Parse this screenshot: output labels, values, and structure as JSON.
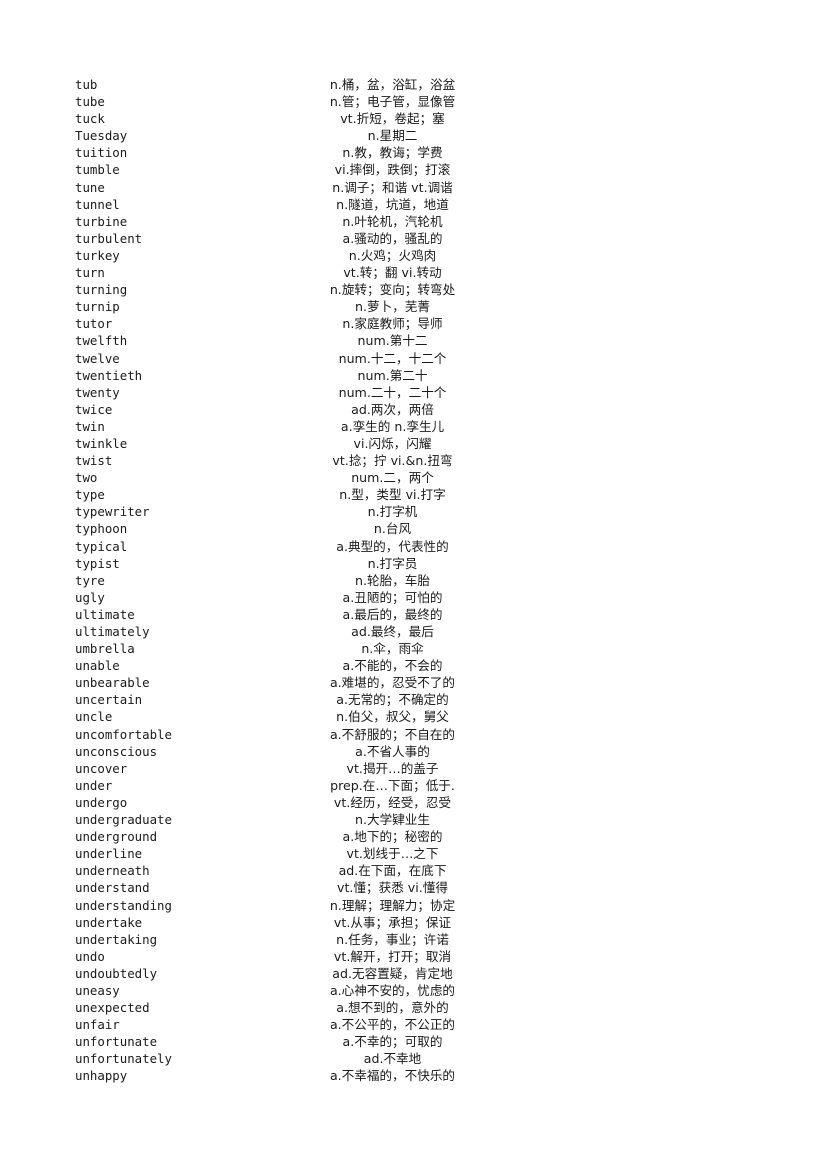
{
  "document": {
    "type": "vocabulary-list",
    "language_pair": "English-Chinese",
    "entry_count": 58,
    "first_term": "tub",
    "last_term": "unhappy"
  },
  "entries": [
    {
      "term": "tub",
      "definition": "n.桶，盆，浴缸，浴盆"
    },
    {
      "term": "tube",
      "definition": "n.管；电子管，显像管"
    },
    {
      "term": "tuck",
      "definition": "vt.折短，卷起；塞"
    },
    {
      "term": "Tuesday",
      "definition": "n.星期二"
    },
    {
      "term": "tuition",
      "definition": "n.教，教诲；学费"
    },
    {
      "term": "tumble",
      "definition": "vi.摔倒，跌倒；打滚"
    },
    {
      "term": "tune",
      "definition": "n.调子；和谐 vt.调谐"
    },
    {
      "term": "tunnel",
      "definition": "n.隧道，坑道，地道"
    },
    {
      "term": "turbine",
      "definition": "n.叶轮机，汽轮机"
    },
    {
      "term": "turbulent",
      "definition": "a.骚动的，骚乱的"
    },
    {
      "term": "turkey",
      "definition": "n.火鸡；火鸡肉"
    },
    {
      "term": "turn",
      "definition": "vt.转；翻 vi.转动"
    },
    {
      "term": "turning",
      "definition": "n.旋转；变向；转弯处"
    },
    {
      "term": "turnip",
      "definition": "n.萝卜，芜菁"
    },
    {
      "term": "tutor",
      "definition": "n.家庭教师；导师"
    },
    {
      "term": "twelfth",
      "definition": "num.第十二"
    },
    {
      "term": "twelve",
      "definition": "num.十二，十二个"
    },
    {
      "term": "twentieth",
      "definition": "num.第二十"
    },
    {
      "term": "twenty",
      "definition": "num.二十，二十个"
    },
    {
      "term": "twice",
      "definition": "ad.两次，两倍"
    },
    {
      "term": "twin",
      "definition": "a.孪生的 n.孪生儿"
    },
    {
      "term": "twinkle",
      "definition": "vi.闪烁，闪耀"
    },
    {
      "term": "twist",
      "definition": "vt.捻；拧 vi.&n.扭弯"
    },
    {
      "term": "two",
      "definition": "num.二，两个"
    },
    {
      "term": "type",
      "definition": "n.型，类型 vi.打字"
    },
    {
      "term": "typewriter",
      "definition": "n.打字机"
    },
    {
      "term": "typhoon",
      "definition": "n.台风"
    },
    {
      "term": "typical",
      "definition": "a.典型的，代表性的"
    },
    {
      "term": "typist",
      "definition": "n.打字员"
    },
    {
      "term": "tyre",
      "definition": "n.轮胎，车胎"
    },
    {
      "term": "ugly",
      "definition": "a.丑陋的；可怕的"
    },
    {
      "term": "ultimate",
      "definition": "a.最后的，最终的"
    },
    {
      "term": "ultimately",
      "definition": "ad.最终，最后"
    },
    {
      "term": "umbrella",
      "definition": "n.伞，雨伞"
    },
    {
      "term": "unable",
      "definition": "a.不能的，不会的"
    },
    {
      "term": "unbearable",
      "definition": "a.难堪的，忍受不了的"
    },
    {
      "term": "uncertain",
      "definition": "a.无常的；不确定的"
    },
    {
      "term": "uncle",
      "definition": "n.伯父，叔父，舅父"
    },
    {
      "term": "uncomfortable",
      "definition": "a.不舒服的；不自在的"
    },
    {
      "term": "unconscious",
      "definition": "a.不省人事的"
    },
    {
      "term": "uncover",
      "definition": "vt.揭开…的盖子"
    },
    {
      "term": "under",
      "definition": "prep.在…下面；低于."
    },
    {
      "term": "undergo",
      "definition": "vt.经历，经受，忍受"
    },
    {
      "term": "undergraduate",
      "definition": "n.大学肄业生"
    },
    {
      "term": "underground",
      "definition": "a.地下的；秘密的"
    },
    {
      "term": "underline",
      "definition": "vt.划线于…之下"
    },
    {
      "term": "underneath",
      "definition": "ad.在下面，在底下"
    },
    {
      "term": "understand",
      "definition": "vt.懂；获悉 vi.懂得"
    },
    {
      "term": "understanding",
      "definition": "n.理解；理解力；协定"
    },
    {
      "term": "undertake",
      "definition": "vt.从事；承担；保证"
    },
    {
      "term": "undertaking",
      "definition": "n.任务，事业；许诺"
    },
    {
      "term": "undo",
      "definition": "vt.解开，打开；取消"
    },
    {
      "term": "undoubtedly",
      "definition": "ad.无容置疑，肯定地"
    },
    {
      "term": "uneasy",
      "definition": "a.心神不安的，忧虑的"
    },
    {
      "term": "unexpected",
      "definition": "a.想不到的，意外的"
    },
    {
      "term": "unfair",
      "definition": "a.不公平的，不公正的"
    },
    {
      "term": "unfortunate",
      "definition": "a.不幸的；可取的"
    },
    {
      "term": "unfortunately",
      "definition": "ad.不幸地"
    },
    {
      "term": "unhappy",
      "definition": "a.不幸福的，不快乐的"
    }
  ]
}
